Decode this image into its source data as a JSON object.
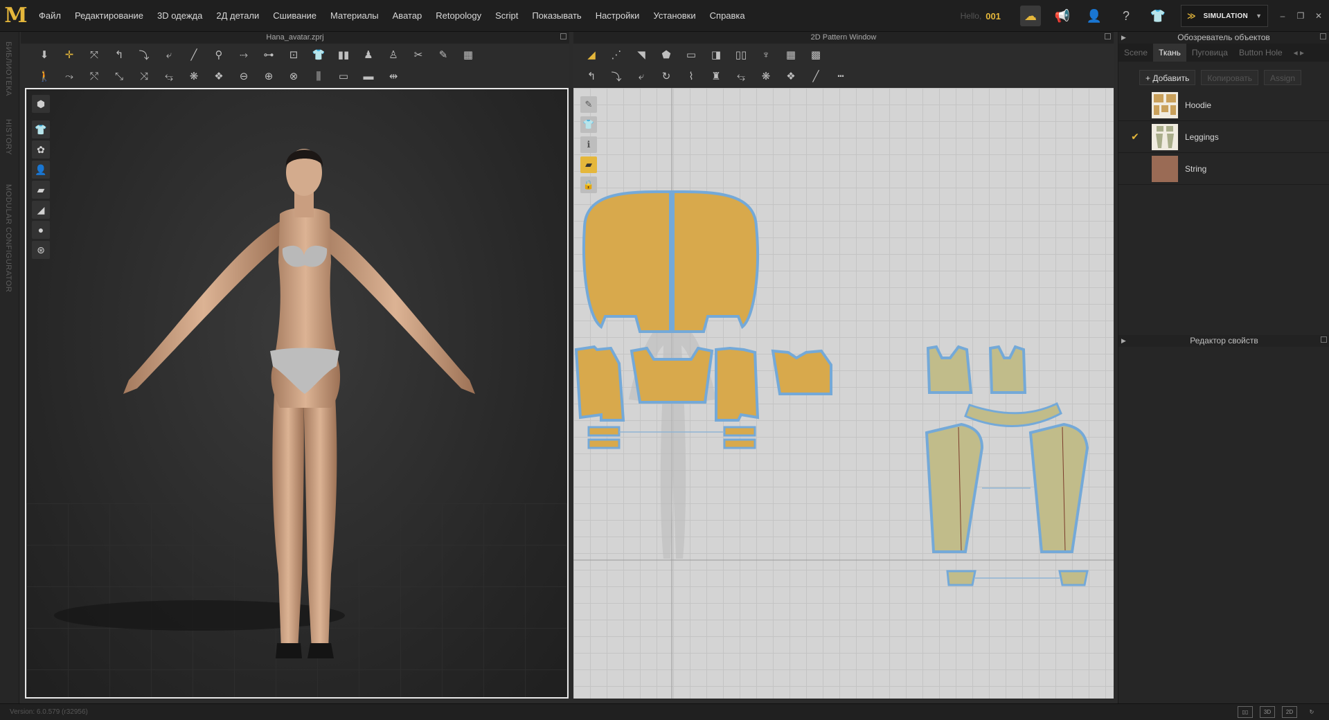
{
  "menu": {
    "items": [
      "Файл",
      "Редактирование",
      "3D одежда",
      "2Д детали",
      "Сшивание",
      "Материалы",
      "Аватар",
      "Retopology",
      "Script",
      "Показывать",
      "Настройки",
      "Установки",
      "Справка"
    ],
    "hello_label": "Hello,",
    "user_id": "001",
    "simulation_label": "SIMULATION"
  },
  "side_tabs": [
    "БИБЛИОТЕКА",
    "HISTORY",
    "MODULAR CONFIGURATOR"
  ],
  "window3d": {
    "title": "Hana_avatar.zprj"
  },
  "window2d": {
    "title": "2D Pattern Window"
  },
  "object_browser": {
    "title": "Обозреватель объектов",
    "tabs": [
      "Scene",
      "Ткань",
      "Пуговица",
      "Button Hole"
    ],
    "active_tab": "Ткань",
    "add_label": "+ Добавить",
    "copy_label": "Копировать",
    "assign_label": "Assign",
    "fabrics": [
      {
        "name": "Hoodie",
        "checked": false,
        "color": "#c9a05a"
      },
      {
        "name": "Leggings",
        "checked": true,
        "color": "#a9ad8a"
      },
      {
        "name": "String",
        "checked": false,
        "color": "#9a6b55"
      }
    ],
    "checkmark": "✔"
  },
  "property_editor": {
    "title": "Редактор свойств"
  },
  "status": {
    "version": "Version: 6.0.579 (r32956)"
  },
  "colors": {
    "accent": "#e5b73b",
    "pattern_fill": "#d8a94c",
    "pattern_outline": "#74a9d8",
    "leggings_fill": "#c1bc8a"
  }
}
